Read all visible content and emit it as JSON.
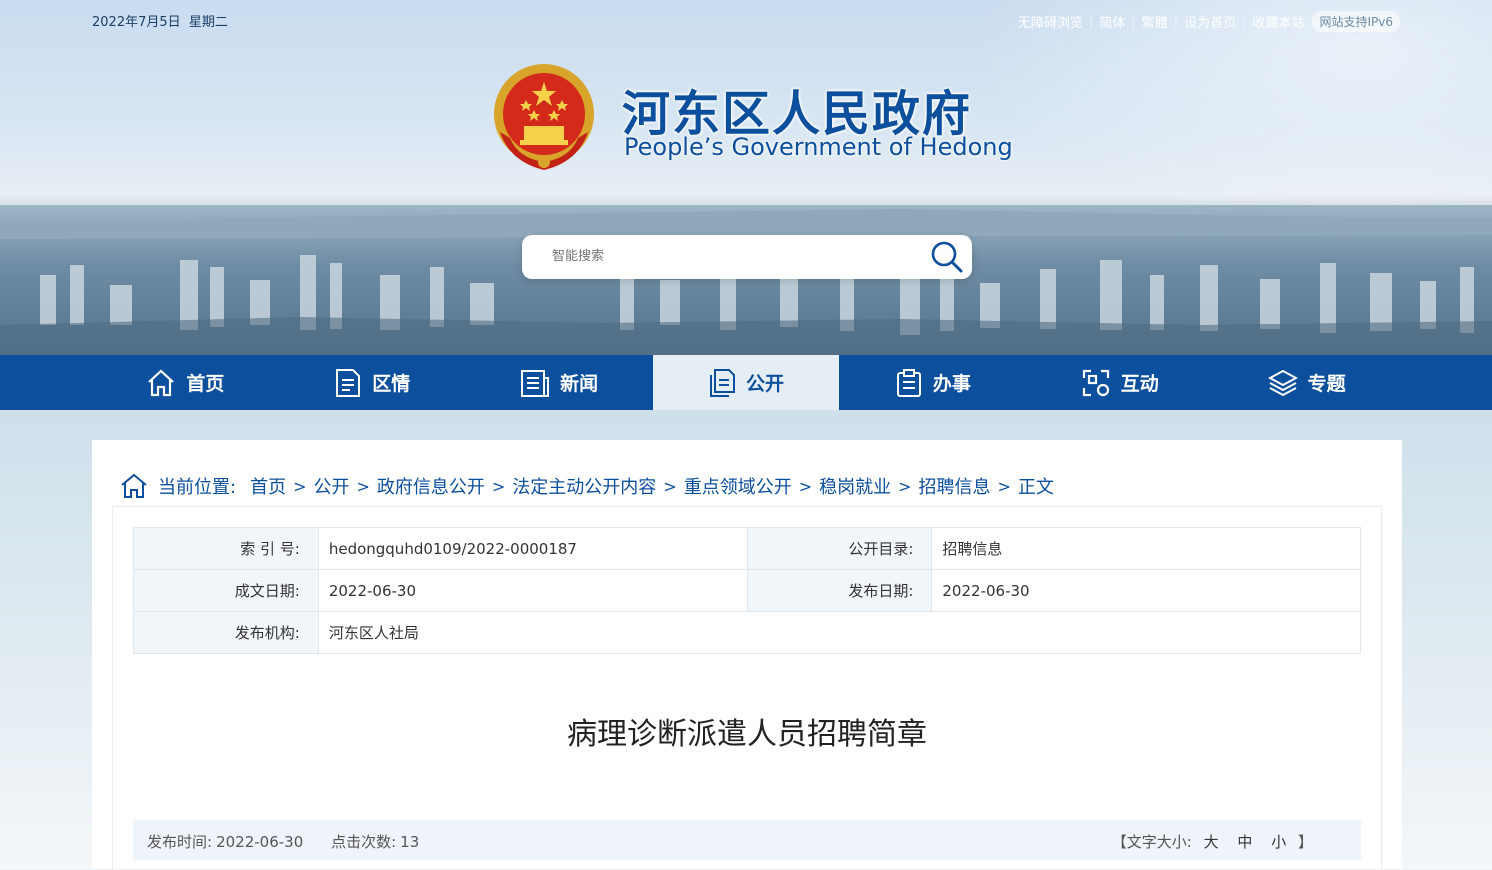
{
  "topbar": {
    "date": "2022年7月5日",
    "weekday": "星期二",
    "links": [
      "无障碍浏览",
      "简体",
      "繁體",
      "设为首页",
      "收藏本站"
    ],
    "ipv6": "网站支持IPv6"
  },
  "header": {
    "title_cn": "河东区人民政府",
    "title_en": "People’s Government of Hedong"
  },
  "search": {
    "placeholder": "智能搜索"
  },
  "nav": {
    "items": [
      {
        "label": "首页",
        "icon": "home-icon"
      },
      {
        "label": "区情",
        "icon": "document-icon"
      },
      {
        "label": "新闻",
        "icon": "news-icon"
      },
      {
        "label": "公开",
        "icon": "files-icon",
        "active": true
      },
      {
        "label": "办事",
        "icon": "clipboard-icon"
      },
      {
        "label": "互动",
        "icon": "interact-icon"
      },
      {
        "label": "专题",
        "icon": "layers-icon"
      }
    ]
  },
  "breadcrumb": {
    "label": "当前位置:",
    "items": [
      "首页",
      "公开",
      "政府信息公开",
      "法定主动公开内容",
      "重点领域公开",
      "稳岗就业",
      "招聘信息",
      "正文"
    ]
  },
  "meta": {
    "index_label": "索 引 号:",
    "index_value": "hedongquhd0109/2022-0000187",
    "catalog_label": "公开目录:",
    "catalog_value": "招聘信息",
    "created_label": "成文日期:",
    "created_value": "2022-06-30",
    "published_label": "发布日期:",
    "published_value": "2022-06-30",
    "org_label": "发布机构:",
    "org_value": "河东区人社局"
  },
  "article": {
    "title": "病理诊断派遣人员招聘简章"
  },
  "info": {
    "pub_time_label": "发布时间:",
    "pub_time": "2022-06-30",
    "clicks_label": "点击次数:",
    "clicks": "13",
    "font_label": "【文字大小:",
    "font_large": "大",
    "font_medium": "中",
    "font_small": "小",
    "font_close": "】"
  },
  "colors": {
    "brand": "#0c4f9d",
    "nav_active_bg": "#e6eef5"
  }
}
